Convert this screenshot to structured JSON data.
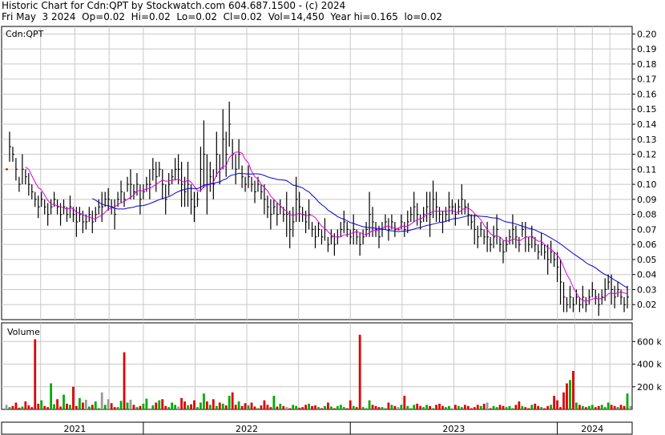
{
  "header": {
    "line1": "Historic Chart for Cdn:QPT by Stockwatch.com 604.687.1500 - (c) 2024",
    "line2": "Fri May  3 2024  Op=0.02  Hi=0.02  Lo=0.02  Cl=0.02  Vol=14,450  Year hi=0.165  lo=0.02"
  },
  "chart_data": {
    "type": "line",
    "price_label": "Cdn:QPT",
    "volume_label": "Volume",
    "price_axis": {
      "ylim": [
        0.01,
        0.205
      ],
      "ticks": [
        "0.20",
        "0.19",
        "0.18",
        "0.17",
        "0.16",
        "0.15",
        "0.14",
        "0.13",
        "0.12",
        "0.11",
        "0.10",
        "0.09",
        "0.08",
        "0.07",
        "0.06",
        "0.05",
        "0.04",
        "0.03",
        "0.02"
      ]
    },
    "volume_axis": {
      "ylim": [
        0,
        680
      ],
      "ticks": [
        {
          "value": 600,
          "label": "600 k"
        },
        {
          "value": 400,
          "label": "400 k"
        },
        {
          "value": 200,
          "label": "200 k"
        }
      ]
    },
    "x_axis": {
      "ticks": [
        "2021",
        "2022",
        "2023",
        "2024"
      ],
      "range_index": [
        0,
        195
      ]
    },
    "year_bounds": [
      0,
      43,
      108,
      173,
      195
    ],
    "close": [
      0.11,
      0.125,
      0.12,
      0.11,
      0.1,
      0.11,
      0.105,
      0.1,
      0.095,
      0.09,
      0.085,
      0.09,
      0.085,
      0.08,
      0.085,
      0.09,
      0.085,
      0.08,
      0.085,
      0.08,
      0.085,
      0.08,
      0.075,
      0.08,
      0.075,
      0.075,
      0.08,
      0.075,
      0.08,
      0.085,
      0.085,
      0.09,
      0.09,
      0.085,
      0.08,
      0.09,
      0.095,
      0.09,
      0.1,
      0.1,
      0.095,
      0.1,
      0.09,
      0.095,
      0.1,
      0.1,
      0.11,
      0.105,
      0.11,
      0.1,
      0.09,
      0.1,
      0.105,
      0.11,
      0.11,
      0.1,
      0.095,
      0.1,
      0.09,
      0.085,
      0.09,
      0.11,
      0.12,
      0.1,
      0.105,
      0.1,
      0.12,
      0.11,
      0.13,
      0.12,
      0.14,
      0.12,
      0.11,
      0.12,
      0.105,
      0.1,
      0.105,
      0.1,
      0.095,
      0.1,
      0.095,
      0.09,
      0.085,
      0.08,
      0.085,
      0.08,
      0.085,
      0.08,
      0.08,
      0.07,
      0.075,
      0.09,
      0.085,
      0.08,
      0.075,
      0.08,
      0.07,
      0.065,
      0.07,
      0.065,
      0.07,
      0.06,
      0.065,
      0.06,
      0.065,
      0.07,
      0.075,
      0.07,
      0.065,
      0.07,
      0.065,
      0.06,
      0.065,
      0.07,
      0.08,
      0.075,
      0.07,
      0.065,
      0.07,
      0.075,
      0.07,
      0.075,
      0.07,
      0.07,
      0.075,
      0.07,
      0.075,
      0.08,
      0.085,
      0.08,
      0.075,
      0.08,
      0.085,
      0.08,
      0.09,
      0.085,
      0.08,
      0.075,
      0.08,
      0.085,
      0.085,
      0.08,
      0.085,
      0.09,
      0.085,
      0.08,
      0.075,
      0.07,
      0.065,
      0.07,
      0.065,
      0.065,
      0.06,
      0.065,
      0.07,
      0.06,
      0.055,
      0.06,
      0.065,
      0.07,
      0.065,
      0.06,
      0.07,
      0.065,
      0.06,
      0.065,
      0.06,
      0.055,
      0.06,
      0.055,
      0.05,
      0.055,
      0.05,
      0.045,
      0.035,
      0.025,
      0.02,
      0.025,
      0.02,
      0.025,
      0.02,
      0.025,
      0.02,
      0.025,
      0.03,
      0.025,
      0.02,
      0.025,
      0.03,
      0.035,
      0.03,
      0.025,
      0.03,
      0.025,
      0.02,
      0.025
    ],
    "spread": [
      0.01,
      0.02,
      0.01,
      0.015,
      0.01,
      0.02,
      0.01,
      0.015,
      0.01,
      0.01,
      0.015,
      0.01,
      0.01,
      0.015,
      0.01,
      0.01,
      0.01,
      0.015,
      0.01,
      0.01,
      0.015,
      0.01,
      0.02,
      0.01,
      0.015,
      0.01,
      0.01,
      0.015,
      0.01,
      0.01,
      0.02,
      0.01,
      0.015,
      0.01,
      0.02,
      0.01,
      0.015,
      0.01,
      0.01,
      0.02,
      0.01,
      0.015,
      0.02,
      0.01,
      0.01,
      0.02,
      0.015,
      0.02,
      0.01,
      0.02,
      0.02,
      0.015,
      0.01,
      0.015,
      0.02,
      0.03,
      0.02,
      0.03,
      0.02,
      0.02,
      0.01,
      0.03,
      0.045,
      0.04,
      0.02,
      0.02,
      0.03,
      0.02,
      0.04,
      0.03,
      0.03,
      0.02,
      0.02,
      0.02,
      0.015,
      0.01,
      0.015,
      0.01,
      0.015,
      0.01,
      0.01,
      0.02,
      0.015,
      0.02,
      0.01,
      0.015,
      0.01,
      0.01,
      0.03,
      0.025,
      0.02,
      0.03,
      0.02,
      0.01,
      0.015,
      0.02,
      0.01,
      0.015,
      0.01,
      0.01,
      0.015,
      0.01,
      0.01,
      0.015,
      0.01,
      0.01,
      0.015,
      0.01,
      0.01,
      0.02,
      0.01,
      0.015,
      0.01,
      0.01,
      0.03,
      0.02,
      0.01,
      0.015,
      0.01,
      0.01,
      0.015,
      0.01,
      0.01,
      0.01,
      0.01,
      0.01,
      0.015,
      0.01,
      0.02,
      0.015,
      0.01,
      0.01,
      0.02,
      0.03,
      0.025,
      0.02,
      0.01,
      0.015,
      0.01,
      0.02,
      0.01,
      0.015,
      0.01,
      0.02,
      0.01,
      0.015,
      0.01,
      0.02,
      0.015,
      0.01,
      0.01,
      0.02,
      0.01,
      0.015,
      0.02,
      0.01,
      0.015,
      0.01,
      0.01,
      0.02,
      0.015,
      0.01,
      0.01,
      0.02,
      0.01,
      0.015,
      0.01,
      0.01,
      0.015,
      0.01,
      0.02,
      0.015,
      0.01,
      0.02,
      0.03,
      0.02,
      0.01,
      0.015,
      0.01,
      0.01,
      0.01,
      0.015,
      0.01,
      0.01,
      0.01,
      0.01,
      0.015,
      0.01,
      0.015,
      0.01,
      0.02,
      0.015,
      0.01,
      0.01,
      0.01,
      0.015,
      0.01
    ],
    "volume": [
      40,
      20,
      30,
      60,
      15,
      25,
      70,
      35,
      20,
      620,
      50,
      80,
      30,
      20,
      230,
      45,
      90,
      25,
      130,
      50,
      40,
      200,
      30,
      100,
      60,
      85,
      25,
      40,
      70,
      10,
      150,
      40,
      90,
      55,
      20,
      20,
      75,
      505,
      60,
      85,
      40,
      20,
      30,
      50,
      95,
      10,
      35,
      60,
      80,
      90,
      30,
      20,
      60,
      40,
      25,
      100,
      70,
      35,
      45,
      80,
      20,
      60,
      140,
      70,
      40,
      90,
      30,
      60,
      50,
      35,
      120,
      150,
      40,
      70,
      30,
      55,
      35,
      60,
      25,
      10,
      35,
      80,
      40,
      20,
      120,
      25,
      50,
      30,
      20,
      10,
      40,
      30,
      15,
      20,
      40,
      50,
      30,
      35,
      20,
      10,
      30,
      60,
      25,
      10,
      30,
      40,
      20,
      10,
      80,
      30,
      20,
      660,
      20,
      10,
      80,
      40,
      30,
      20,
      20,
      10,
      60,
      40,
      30,
      20,
      40,
      120,
      30,
      10,
      40,
      50,
      30,
      20,
      40,
      30,
      10,
      40,
      50,
      30,
      20,
      30,
      10,
      40,
      30,
      20,
      40,
      30,
      10,
      20,
      40,
      30,
      50,
      60,
      10,
      30,
      20,
      40,
      30,
      20,
      30,
      10,
      40,
      70,
      30,
      20,
      10,
      40,
      50,
      30,
      20,
      10,
      30,
      40,
      120,
      80,
      20,
      150,
      230,
      260,
      340,
      60,
      40,
      30,
      20,
      30,
      40,
      20,
      30,
      40,
      20,
      60,
      40,
      30,
      20,
      40,
      30,
      140,
      30
    ],
    "series": [
      {
        "color": "#000000"
      },
      {
        "color": "#dd00dd"
      },
      {
        "color": "#0000cc"
      }
    ],
    "colors": {
      "up": "#00aa00",
      "down": "#dd0000",
      "flat": "#999999",
      "grid": "#c8c8c8",
      "price_bar": "#000000",
      "unchanged_tick": "#dd0000"
    }
  }
}
